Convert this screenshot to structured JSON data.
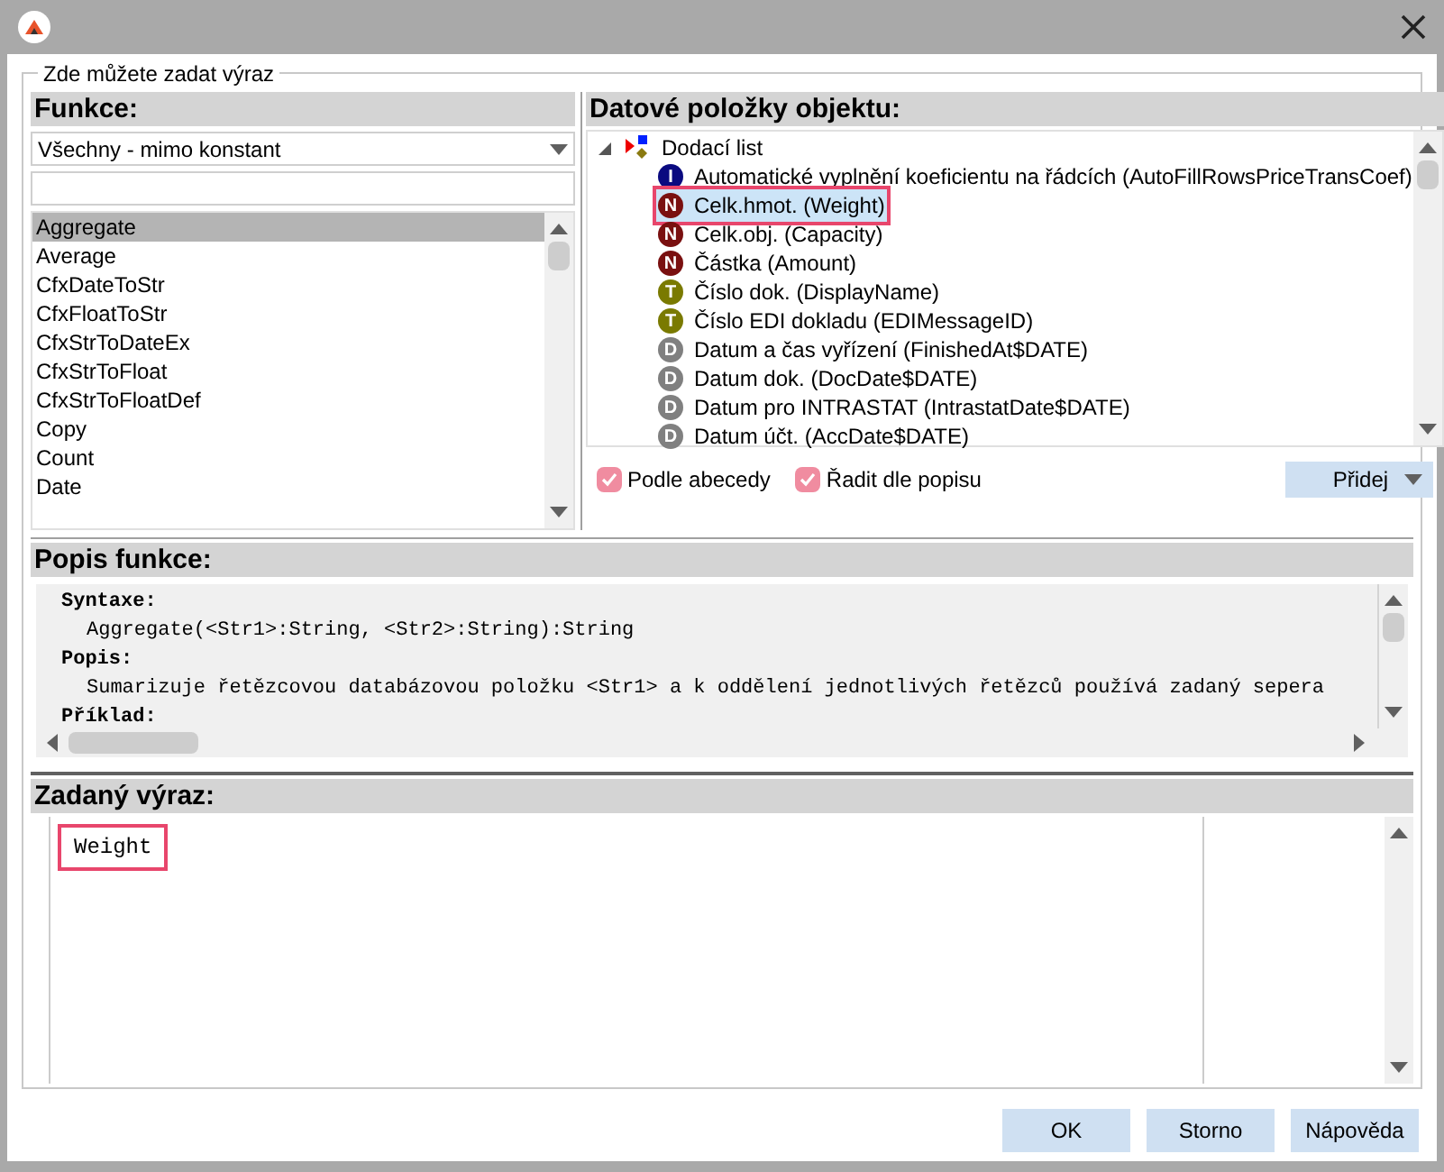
{
  "group_title": "Zde můžete zadat výraz",
  "functions": {
    "heading": "Funkce:",
    "filter": "Všechny - mimo konstant",
    "items": [
      {
        "label": "Aggregate",
        "selected": true
      },
      {
        "label": "Average",
        "selected": false
      },
      {
        "label": "CfxDateToStr",
        "selected": false
      },
      {
        "label": "CfxFloatToStr",
        "selected": false
      },
      {
        "label": "CfxStrToDateEx",
        "selected": false
      },
      {
        "label": "CfxStrToFloat",
        "selected": false
      },
      {
        "label": "CfxStrToFloatDef",
        "selected": false
      },
      {
        "label": "Copy",
        "selected": false
      },
      {
        "label": "Count",
        "selected": false
      },
      {
        "label": "Date",
        "selected": false
      }
    ]
  },
  "data_items": {
    "heading": "Datové položky objektu:",
    "root": {
      "label": "Dodací list",
      "expanded": true,
      "children": [
        {
          "kind": "integer",
          "badge": "I",
          "label": "Automatické vyplnění koeficientu na řádcích  (AutoFillRowsPriceTransCoef)",
          "selected": false
        },
        {
          "kind": "number",
          "badge": "N",
          "label": "Celk.hmot.  (Weight)",
          "selected": true
        },
        {
          "kind": "number",
          "badge": "N",
          "label": "Celk.obj.  (Capacity)",
          "selected": false
        },
        {
          "kind": "number",
          "badge": "N",
          "label": "Částka  (Amount)",
          "selected": false
        },
        {
          "kind": "text",
          "badge": "T",
          "label": "Číslo dok.  (DisplayName)",
          "selected": false
        },
        {
          "kind": "text",
          "badge": "T",
          "label": "Číslo EDI dokladu  (EDIMessageID)",
          "selected": false
        },
        {
          "kind": "date",
          "badge": "D",
          "label": "Datum a čas vyřízení  (FinishedAt$DATE)",
          "selected": false
        },
        {
          "kind": "date",
          "badge": "D",
          "label": "Datum dok.  (DocDate$DATE)",
          "selected": false
        },
        {
          "kind": "date",
          "badge": "D",
          "label": "Datum pro INTRASTAT  (IntrastatDate$DATE)",
          "selected": false
        },
        {
          "kind": "date",
          "badge": "D",
          "label": "Datum účt.  (AccDate$DATE)",
          "selected": false
        }
      ]
    },
    "options": [
      {
        "label": "Podle abecedy",
        "checked": true
      },
      {
        "label": "Řadit dle popisu",
        "checked": true
      }
    ],
    "add_button": "Přidej"
  },
  "description": {
    "heading": "Popis funkce:",
    "lines": [
      {
        "kind": "label",
        "text": "Syntaxe:"
      },
      {
        "kind": "body",
        "text": "Aggregate(<Str1>:String, <Str2>:String):String"
      },
      {
        "kind": "label",
        "text": "Popis:"
      },
      {
        "kind": "body",
        "text": "Sumarizuje řetězcovou databázovou položku <Str1> a k oddělení jednotlivých řetězců používá zadaný sepera"
      },
      {
        "kind": "label",
        "text": "Příklad:"
      }
    ]
  },
  "expression": {
    "heading": "Zadaný výraz:",
    "value": "Weight",
    "highlighted": true
  },
  "buttons": [
    "OK",
    "Storno",
    "Nápověda"
  ]
}
